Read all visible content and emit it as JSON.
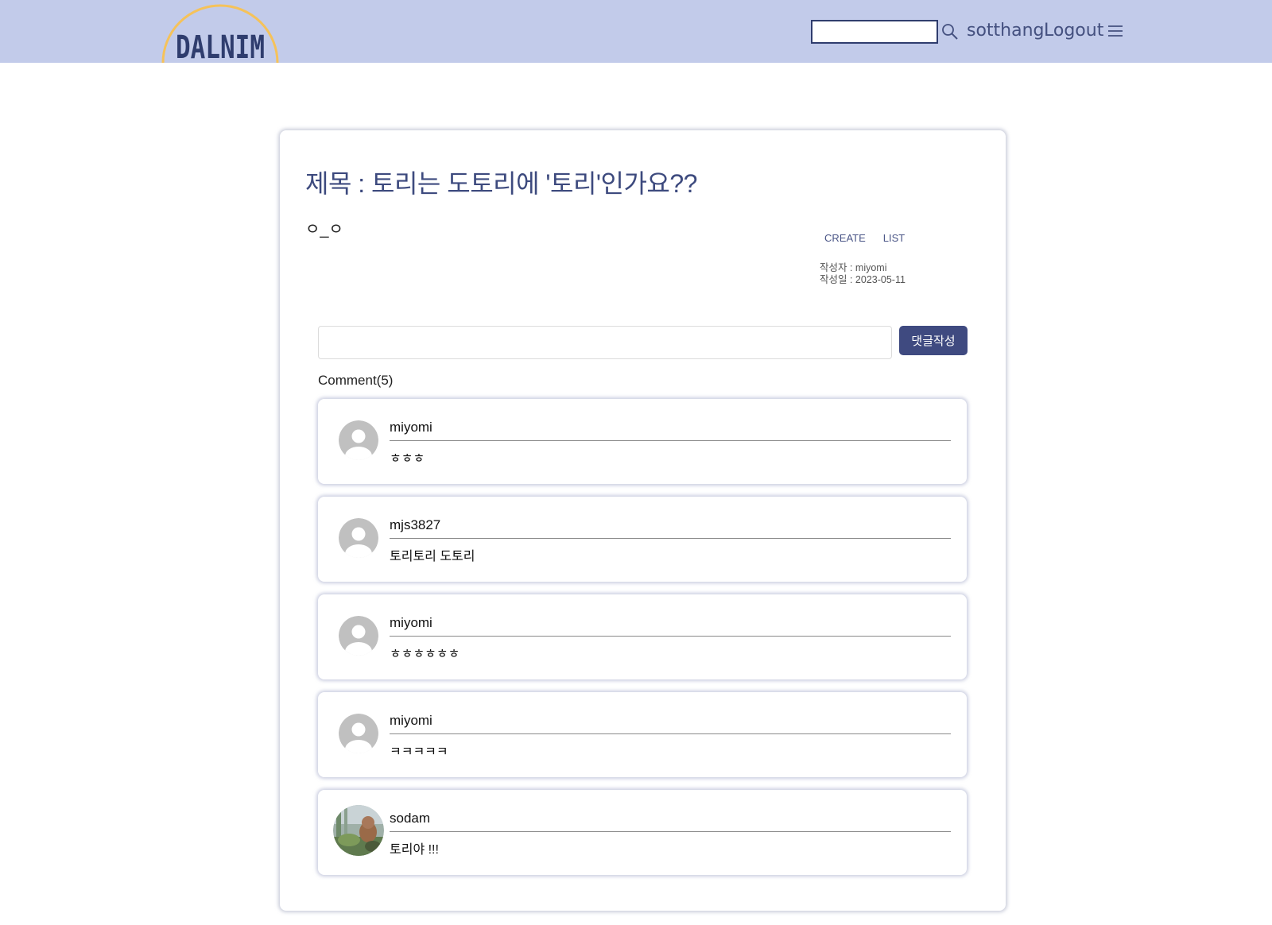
{
  "header": {
    "logo_text": "DALNIM",
    "search_value": "",
    "username": "sotthang",
    "logout_label": "Logout",
    "icons": [
      "search-icon",
      "menu-icon"
    ],
    "background_color": "#c2cbea",
    "logo_arc_color": "#f5c25a",
    "logo_text_color": "#2f3d6e"
  },
  "post": {
    "title": "제목 : 토리는 도토리에 '토리'인가요??",
    "body": "ㅇ_ㅇ",
    "create_label": "CREATE",
    "list_label": "LIST",
    "author_line": "작성자 : miyomi",
    "date_line": "작성일 : 2023-05-11"
  },
  "comment_form": {
    "input_value": "",
    "submit_label": "댓글작성",
    "button_color": "#3f4a80"
  },
  "comments_header": "Comment(5)",
  "comments": [
    {
      "author": "miyomi",
      "text": "ㅎㅎㅎ",
      "avatar": "default-avatar"
    },
    {
      "author": "mjs3827",
      "text": "토리토리 도토리",
      "avatar": "default-avatar"
    },
    {
      "author": "miyomi",
      "text": "ㅎㅎㅎㅎㅎㅎ",
      "avatar": "default-avatar"
    },
    {
      "author": "miyomi",
      "text": "ㅋㅋㅋㅋㅋ",
      "avatar": "default-avatar"
    },
    {
      "author": "sodam",
      "text": "토리야 !!!",
      "avatar": "photo-avatar"
    }
  ]
}
